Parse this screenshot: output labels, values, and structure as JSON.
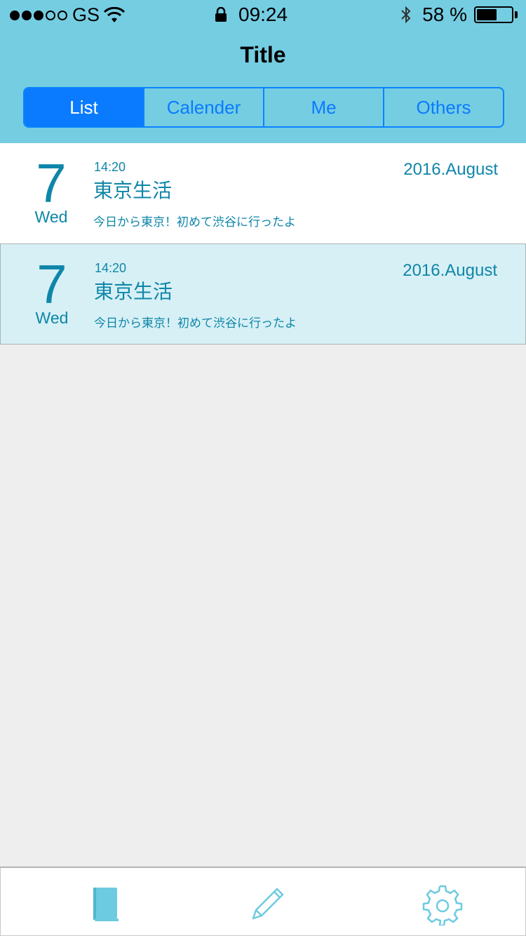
{
  "status_bar": {
    "carrier": "GS",
    "time": "09:24",
    "battery": "58 %",
    "signal_bars_filled": 3,
    "signal_bars_total": 5,
    "battery_level": 0.58
  },
  "header": {
    "title": "Title"
  },
  "segments": [
    {
      "label": "List",
      "active": true
    },
    {
      "label": "Calender",
      "active": false
    },
    {
      "label": "Me",
      "active": false
    },
    {
      "label": "Others",
      "active": false
    }
  ],
  "entries": [
    {
      "day": "7",
      "weekday": "Wed",
      "time": "14:20",
      "title": "東京生活",
      "body": "今日から東京！初めて渋谷に行ったよ",
      "month": "2016.August",
      "selected": false
    },
    {
      "day": "7",
      "weekday": "Wed",
      "time": "14:20",
      "title": "東京生活",
      "body": "今日から東京！初めて渋谷に行ったよ",
      "month": "2016.August",
      "selected": true
    }
  ],
  "tabbar": {
    "icons": [
      "book-icon",
      "pencil-icon",
      "gear-icon"
    ]
  },
  "colors": {
    "header_bg": "#75cde2",
    "accent_blue": "#0a7bff",
    "text_teal": "#0f86a9",
    "selected_row_bg": "#d7f0f5",
    "tab_icon": "#6ccbe0"
  }
}
